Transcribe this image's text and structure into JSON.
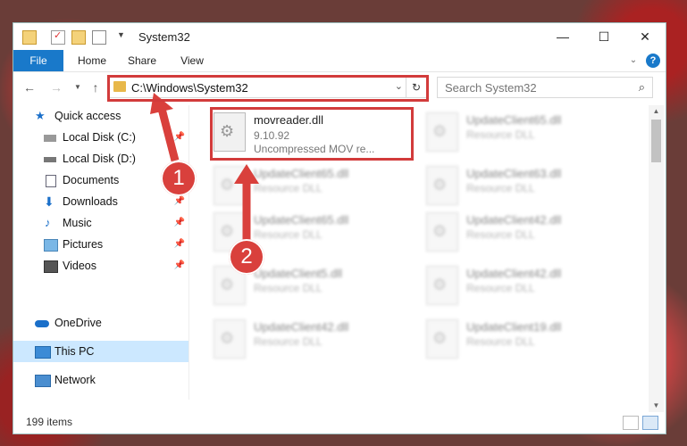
{
  "window": {
    "title": "System32",
    "controls": {
      "minimize": "—",
      "maximize": "☐",
      "close": "✕"
    }
  },
  "ribbon": {
    "tabs": [
      "File",
      "Home",
      "Share",
      "View"
    ],
    "help": "?"
  },
  "address": {
    "path": "C:\\Windows\\System32",
    "search_placeholder": "Search System32"
  },
  "nav": {
    "items": [
      {
        "label": "Quick access",
        "icon": "star-icon"
      },
      {
        "label": "Local Disk (C:)",
        "icon": "drive-icon",
        "pinned": true
      },
      {
        "label": "Local Disk (D:)",
        "icon": "drive-icon"
      },
      {
        "label": "Documents",
        "icon": "documents-icon"
      },
      {
        "label": "Downloads",
        "icon": "downloads-icon",
        "pinned": true
      },
      {
        "label": "Music",
        "icon": "music-icon",
        "pinned": true
      },
      {
        "label": "Pictures",
        "icon": "pictures-icon",
        "pinned": true
      },
      {
        "label": "Videos",
        "icon": "videos-icon",
        "pinned": true
      },
      {
        "label": "OneDrive",
        "icon": "onedrive-icon"
      },
      {
        "label": "This PC",
        "icon": "this-pc-icon",
        "selected": true
      },
      {
        "label": "Network",
        "icon": "network-icon"
      }
    ]
  },
  "files": {
    "selected": {
      "name": "movreader.dll",
      "version": "9.10.92",
      "description": "Uncompressed MOV re..."
    },
    "others": [
      {
        "name": "UpdateClient65.dll",
        "description": "Resource DLL"
      },
      {
        "name": "UpdateClient65.dll",
        "description": "Resource DLL"
      },
      {
        "name": "UpdateClient63.dll",
        "description": "Resource DLL"
      },
      {
        "name": "UpdateClient65.dll",
        "description": "Resource DLL"
      },
      {
        "name": "UpdateClient42.dll",
        "description": "Resource DLL"
      },
      {
        "name": "UpdateClient5.dll",
        "description": "Resource DLL"
      },
      {
        "name": "UpdateClient42.dll",
        "description": "Resource DLL"
      },
      {
        "name": "UpdateClient42.dll",
        "description": "Resource DLL"
      },
      {
        "name": "UpdateClient19.dll",
        "description": "Resource DLL"
      }
    ]
  },
  "status": {
    "count": "199 items"
  },
  "annotations": {
    "step1": "1",
    "step2": "2"
  },
  "colors": {
    "accent": "#1979ca",
    "highlight": "#d23b3b",
    "selected_nav": "#cce8ff"
  }
}
